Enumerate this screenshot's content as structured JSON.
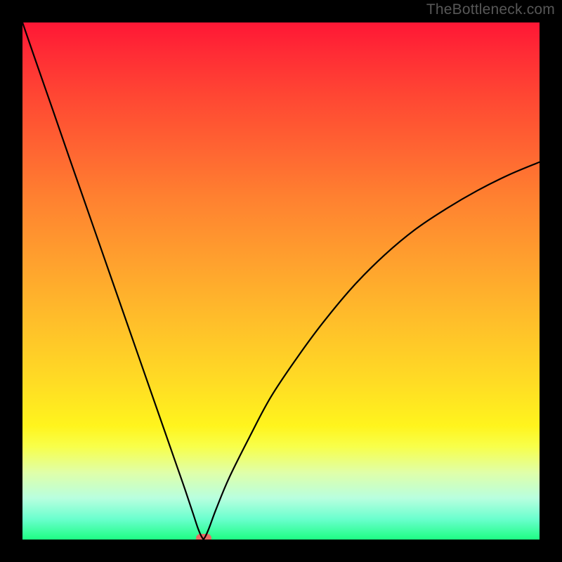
{
  "watermark": "TheBottleneck.com",
  "colors": {
    "curve_stroke": "#000000",
    "marker_fill": "#e96b63",
    "background": "#000000",
    "gradient_top": "#ff1735",
    "gradient_bottom": "#1efd83"
  },
  "chart_data": {
    "type": "line",
    "title": "",
    "xlabel": "",
    "ylabel": "",
    "xlim": [
      0,
      100
    ],
    "ylim": [
      0,
      100
    ],
    "legend": false,
    "grid": false,
    "annotations": [],
    "series": [
      {
        "name": "bottleneck-curve",
        "x": [
          0,
          3,
          6,
          9,
          12,
          15,
          18,
          21,
          24,
          27,
          30,
          31.5,
          33,
          34,
          34.8,
          35.2,
          36,
          37.5,
          40,
          44,
          48,
          53,
          58,
          64,
          70,
          76,
          82,
          88,
          94,
          100
        ],
        "y": [
          100,
          91.3,
          82.7,
          74.0,
          65.4,
          56.8,
          48.2,
          39.6,
          31.0,
          22.4,
          13.8,
          9.5,
          5.0,
          2.0,
          0.3,
          0.3,
          2.0,
          6.0,
          12.0,
          20.0,
          27.5,
          35.0,
          41.8,
          49.0,
          55.0,
          60.0,
          64.0,
          67.5,
          70.5,
          73.0
        ]
      }
    ],
    "marker": {
      "x": 35,
      "y": 0.3
    },
    "notes": "V-shaped bottleneck curve over vertical color gradient (red→yellow→green). Minimum near x≈35. No axis ticks or labels are shown; percentages are read relative to the plot box."
  }
}
